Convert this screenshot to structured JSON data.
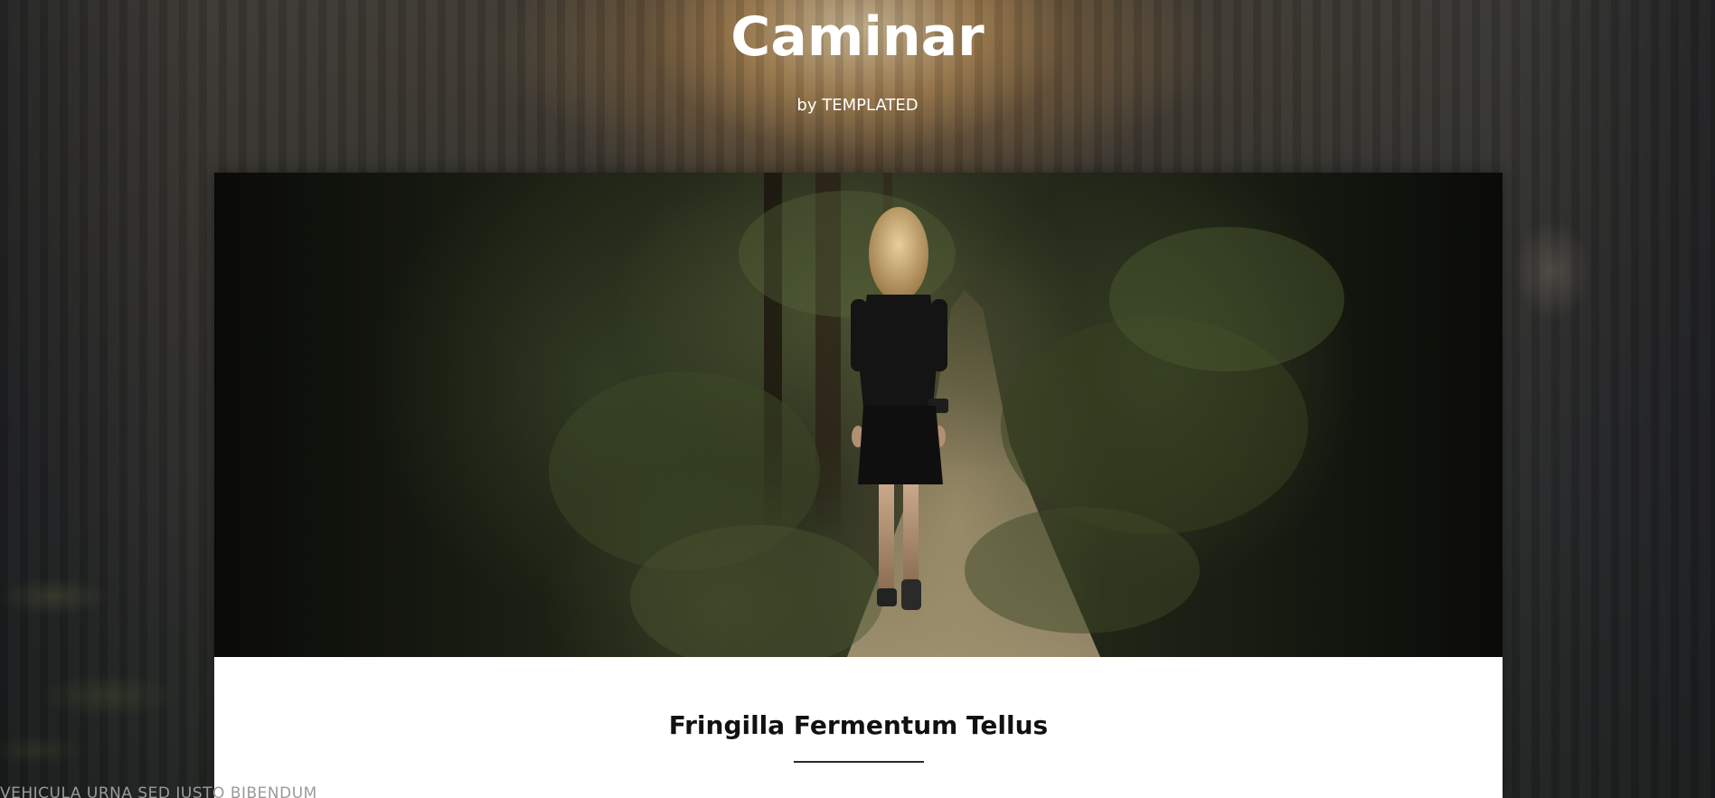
{
  "site": {
    "title": "Caminar",
    "subtitle": "by TEMPLATED"
  },
  "post": {
    "image_alt": "Woman walking on a forest path",
    "title": "Fringilla Fermentum Tellus",
    "subtitle": "Vehicula urna sed justo bibendum"
  },
  "colors": {
    "background": "#24262b",
    "accent_glow": "#a8824f",
    "card": "#ffffff",
    "title_text": "#111111",
    "subtitle_text": "#9a9a9a"
  }
}
